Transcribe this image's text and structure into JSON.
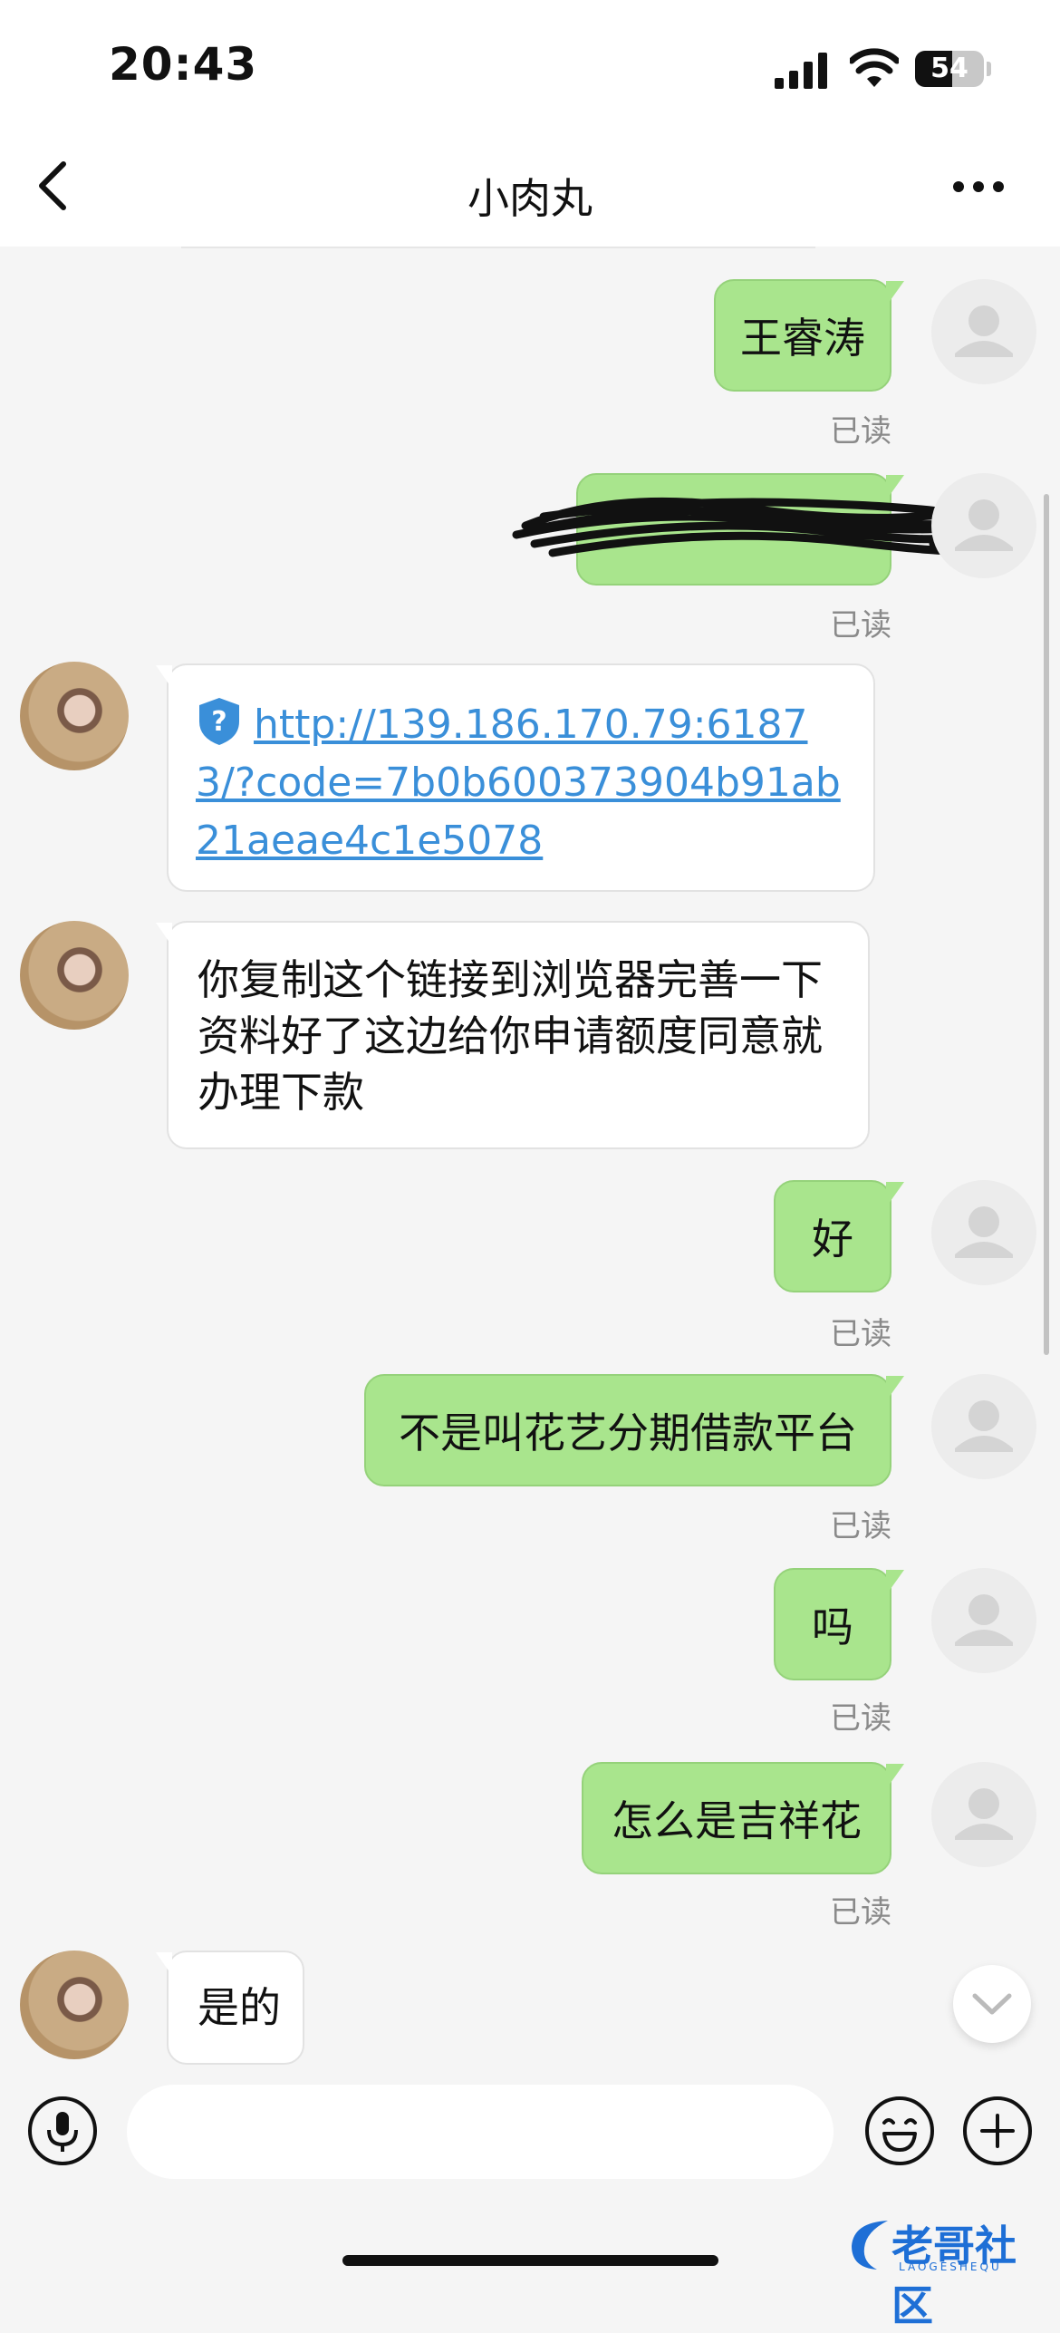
{
  "status": {
    "time": "20:43",
    "battery": "54"
  },
  "header": {
    "title": "小肉丸"
  },
  "messages": {
    "m1": {
      "text": "王睿涛",
      "status": "已读"
    },
    "m2": {
      "status": "已读"
    },
    "m3": {
      "link": "http://139.186.170.79:61873/?code=7b0b600373904b91ab21aeae4c1e5078"
    },
    "m4": {
      "text": "你复制这个链接到浏览器完善一下资料好了这边给你申请额度同意就办理下款"
    },
    "m5": {
      "text": "好",
      "status": "已读"
    },
    "m6": {
      "text": "不是叫花艺分期借款平台",
      "status": "已读"
    },
    "m7": {
      "text": "吗",
      "status": "已读"
    },
    "m8": {
      "text": "怎么是吉祥花",
      "status": "已读"
    },
    "m9": {
      "text": "是的"
    }
  },
  "watermark": {
    "text": "老哥社区",
    "sub": "LAOGESHEQU"
  },
  "colors": {
    "sent_bubble": "#a9e58d",
    "link": "#3a8fd9",
    "background": "#f5f5f5"
  }
}
